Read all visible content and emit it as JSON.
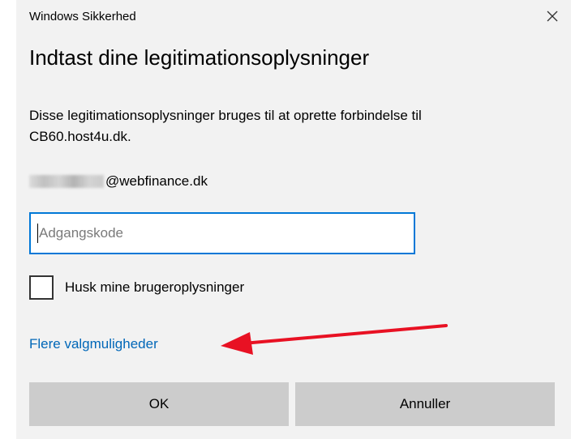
{
  "window": {
    "title": "Windows Sikkerhed",
    "close_glyph": "✕"
  },
  "dialog": {
    "heading": "Indtast dine legitimationsoplysninger",
    "description_line1": "Disse legitimationsoplysninger bruges til at oprette forbindelse til",
    "description_line2": "CB60.host4u.dk.",
    "username_domain": "@webfinance.dk",
    "password_placeholder": "Adgangskode",
    "remember_label": "Husk mine brugeroplysninger",
    "remember_checked": false,
    "more_options_link": "Flere valgmuligheder",
    "ok_label": "OK",
    "cancel_label": "Annuller"
  },
  "colors": {
    "dialog_background": "#f2f2f2",
    "accent": "#0078d7",
    "link": "#0067b8",
    "button_background": "#cccccc",
    "annotation_arrow": "#e81123"
  },
  "icons": {
    "close": "close-icon",
    "annotation": "red-arrow-icon"
  }
}
